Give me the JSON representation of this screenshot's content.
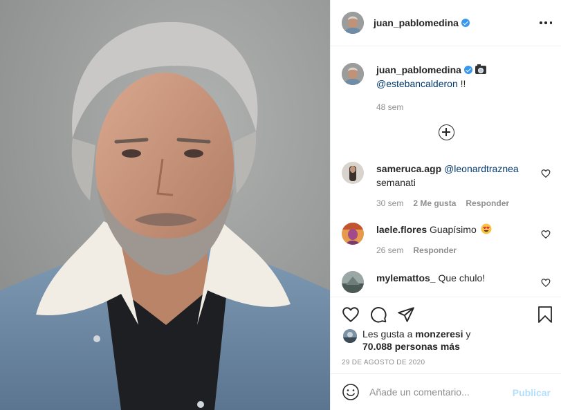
{
  "post": {
    "author": "juan_pablomedina",
    "image_alt": "Retrato de hombre con chaqueta de mezclilla"
  },
  "header": {
    "username": "juan_pablomedina",
    "verified_icon": "verified-badge-icon",
    "more_icon": "more-options-icon"
  },
  "caption": {
    "username": "juan_pablomedina",
    "emoji": "camera-emoji",
    "mention": "@estebancalderon",
    "text": " !!",
    "time": "48 sem"
  },
  "load_more_icon": "plus-circle-icon",
  "comments": [
    {
      "username": "sameruca.agp",
      "mention": "@leonardtraznea",
      "text": "semanati",
      "time": "30 sem",
      "likes": "2 Me gusta",
      "reply": "Responder"
    },
    {
      "username": "laele.flores",
      "text": "Guapísimo",
      "emoji": "heart-eyes-emoji",
      "time": "26 sem",
      "reply": "Responder"
    },
    {
      "username": "mylemattos_",
      "text": "Que chulo!"
    }
  ],
  "actions": {
    "like_icon": "heart-icon",
    "comment_icon": "comment-icon",
    "share_icon": "share-icon",
    "save_icon": "bookmark-icon"
  },
  "likes": {
    "prefix": "Les gusta a ",
    "user": "monzeresi",
    "connector": " y",
    "others": "70.088 personas más"
  },
  "date": "29 DE AGOSTO DE 2020",
  "add_comment": {
    "placeholder": "Añade un comentario...",
    "publish_label": "Publicar"
  },
  "colors": {
    "accent": "#3897f0",
    "link": "#00376b",
    "muted": "#8e8e8e",
    "publish_disabled": "#b2dffc"
  }
}
